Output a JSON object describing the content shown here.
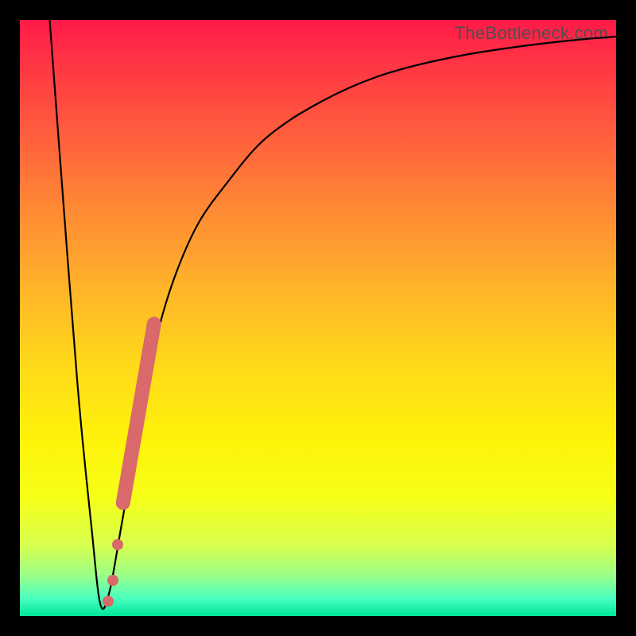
{
  "watermark": "TheBottleneck.com",
  "chart_data": {
    "type": "line",
    "title": "",
    "xlabel": "",
    "ylabel": "",
    "xlim": [
      0,
      100
    ],
    "ylim": [
      0,
      100
    ],
    "grid": false,
    "legend": false,
    "series": [
      {
        "name": "curve",
        "style": "line",
        "color": "#000000",
        "x": [
          5,
          8,
          10,
          12,
          13.5,
          15,
          17,
          20,
          23,
          26,
          30,
          35,
          40,
          45,
          50,
          55,
          60,
          65,
          70,
          75,
          80,
          85,
          90,
          95,
          100
        ],
        "y": [
          100,
          60,
          35,
          15,
          2,
          4,
          15,
          32,
          47,
          57,
          66,
          73,
          79,
          83,
          86,
          88.5,
          90.5,
          92,
          93.2,
          94.2,
          95,
          95.7,
          96.3,
          96.8,
          97.2
        ]
      },
      {
        "name": "highlight-segment",
        "style": "thick-line",
        "color": "#d9696b",
        "x": [
          17.3,
          22.5
        ],
        "y": [
          19,
          49
        ]
      },
      {
        "name": "highlight-dots",
        "style": "points",
        "color": "#d9696b",
        "x": [
          14.8,
          15.6,
          16.4
        ],
        "y": [
          2.5,
          6,
          12
        ]
      }
    ]
  }
}
